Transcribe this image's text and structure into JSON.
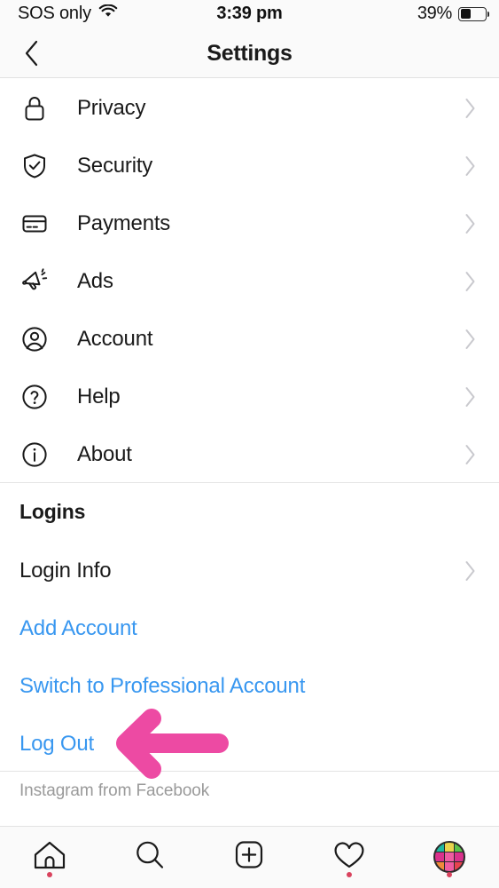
{
  "status_bar": {
    "carrier": "SOS only",
    "wifi_icon": "wifi-icon",
    "time": "3:39 pm",
    "battery_percent": "39%",
    "battery_level": 39
  },
  "nav": {
    "back_icon": "chevron-left-icon",
    "title": "Settings"
  },
  "settings_rows": [
    {
      "label": "Privacy",
      "icon": "lock-icon",
      "chevron": "chevron-right-icon"
    },
    {
      "label": "Security",
      "icon": "shield-check-icon",
      "chevron": "chevron-right-icon"
    },
    {
      "label": "Payments",
      "icon": "credit-card-icon",
      "chevron": "chevron-right-icon"
    },
    {
      "label": "Ads",
      "icon": "megaphone-icon",
      "chevron": "chevron-right-icon"
    },
    {
      "label": "Account",
      "icon": "person-circle-icon",
      "chevron": "chevron-right-icon"
    },
    {
      "label": "Help",
      "icon": "question-circle-icon",
      "chevron": "chevron-right-icon"
    },
    {
      "label": "About",
      "icon": "info-circle-icon",
      "chevron": "chevron-right-icon"
    }
  ],
  "logins": {
    "header": "Logins",
    "login_info": "Login Info",
    "login_info_chevron": "chevron-right-icon",
    "add_account": "Add Account",
    "switch_professional": "Switch to Professional Account",
    "log_out": "Log Out"
  },
  "footer": {
    "attribution": "Instagram from Facebook"
  },
  "annotation": {
    "type": "arrow-left",
    "color": "#ed4aa3",
    "points_at": "Log Out"
  },
  "tab_bar": [
    {
      "icon": "home-icon",
      "has_dot": true
    },
    {
      "icon": "search-icon",
      "has_dot": false
    },
    {
      "icon": "add-post-icon",
      "has_dot": false
    },
    {
      "icon": "heart-icon",
      "has_dot": true
    },
    {
      "icon": "profile-avatar-icon",
      "has_dot": true
    }
  ],
  "colors": {
    "link_blue": "#3897f0",
    "text_dark": "#1a1a1a",
    "text_muted": "#9a9a9a",
    "chevron_gray": "#c9c9ce",
    "accent_pink": "#ed4aa3",
    "badge_red": "#d9435e"
  },
  "avatar_grid": [
    "#1fb9a0",
    "#e8d44d",
    "#5cc24a",
    "#d9318c",
    "#ef5ba1",
    "#d9318c",
    "#f08a3c",
    "#ef5ba1",
    "#e8434f"
  ]
}
